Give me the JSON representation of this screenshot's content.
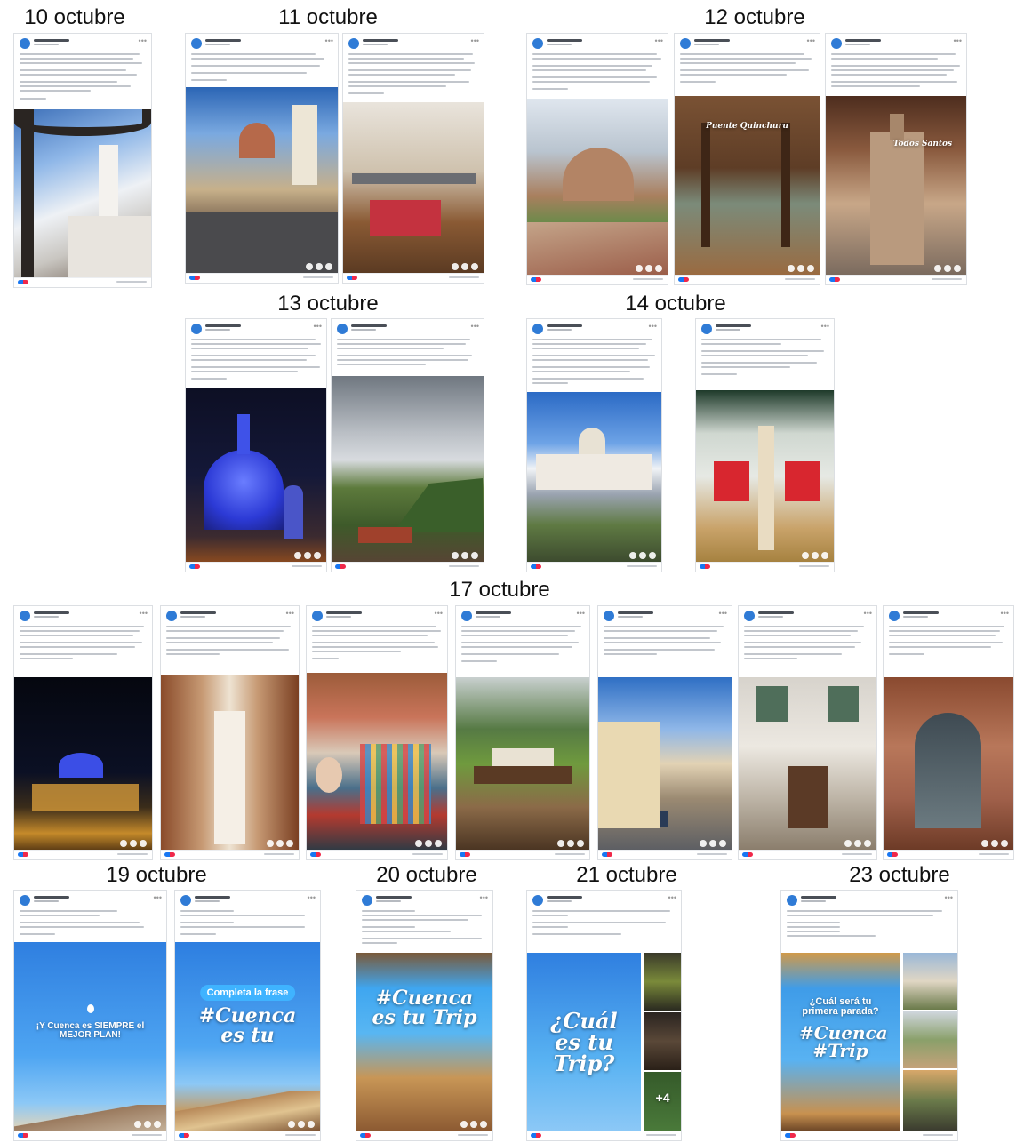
{
  "dates": {
    "d10": "10 octubre",
    "d11": "11 octubre",
    "d12": "12 octubre",
    "d13": "13 octubre",
    "d14": "14 octubre",
    "d17": "17 octubre",
    "d19": "19 octubre",
    "d20": "20 octubre",
    "d21": "21 octubre",
    "d23": "23 octubre"
  },
  "overlays": {
    "bridge": "Puente Quinchuru",
    "church": "Todos Santos",
    "blue_ad": "¡Y Cuenca es SIEMPRE el MEJOR PLAN!",
    "pill": "Completa la frase",
    "cuenca_es_tu": "#Cuenca es tu",
    "cuenca_es_tu_trip": "#Cuenca es tu Trip",
    "cual_trip": "¿Cuál es tu Trip?",
    "plus_four": "+4",
    "primera_parada": "¿Cuál será tu primera parada?",
    "cuenca_trip": "#Cuenca #Trip"
  },
  "colors": {
    "brand_blue": "#2f7bd6",
    "like_blue": "#1877f2",
    "heart_red": "#f0284a",
    "card_border": "#dcdfe3"
  }
}
